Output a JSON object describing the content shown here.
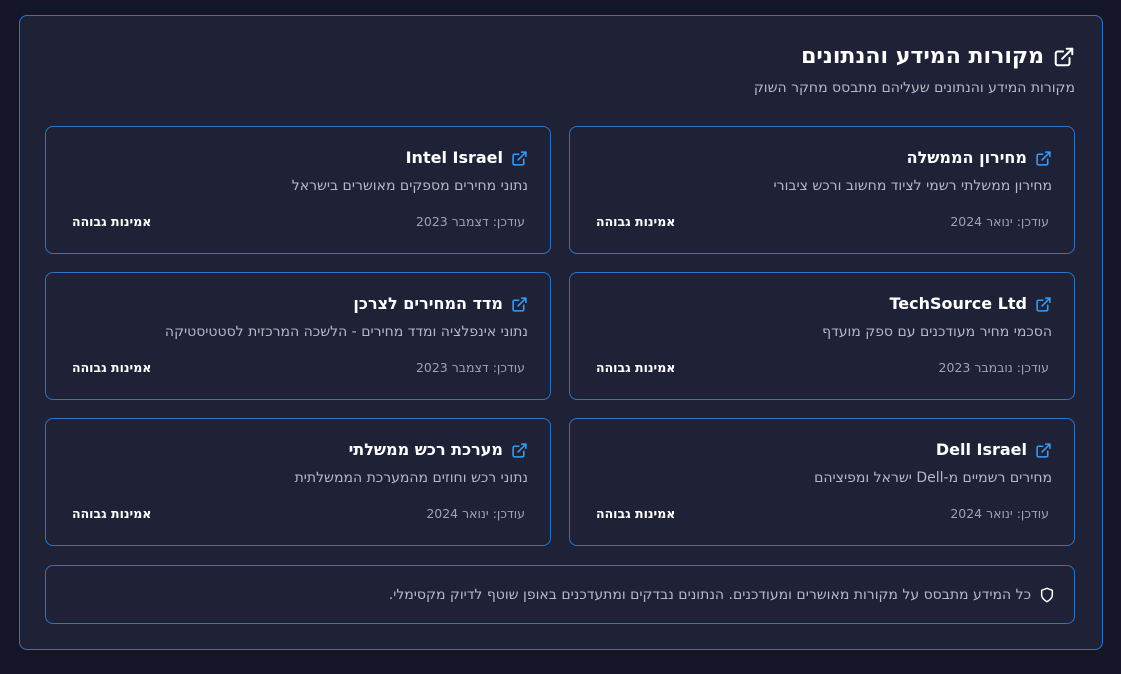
{
  "header": {
    "title": "מקורות המידע והנתונים",
    "subtitle": "מקורות המידע והנתונים שעליהם מתבסס מחקר השוק",
    "icon": "external-link-icon"
  },
  "sources": [
    {
      "name": "מחירון הממשלה",
      "description": "מחירון ממשלתי רשמי לציוד מחשוב ורכש ציבורי",
      "updated": "עודכן: ינואר 2024",
      "reliability": "אמינות גבוהה"
    },
    {
      "name": "Intel Israel",
      "description": "נתוני מחירים מספקים מאושרים בישראל",
      "updated": "עודכן: דצמבר 2023",
      "reliability": "אמינות גבוהה"
    },
    {
      "name": "TechSource Ltd",
      "description": "הסכמי מחיר מעודכנים עם ספק מועדף",
      "updated": "עודכן: נובמבר 2023",
      "reliability": "אמינות גבוהה"
    },
    {
      "name": "מדד המחירים לצרכן",
      "description": "נתוני אינפלציה ומדד מחירים - הלשכה המרכזית לסטטיסטיקה",
      "updated": "עודכן: דצמבר 2023",
      "reliability": "אמינות גבוהה"
    },
    {
      "name": "Dell Israel",
      "description": "מחירים רשמיים מ-Dell ישראל ומפיציהם",
      "updated": "עודכן: ינואר 2024",
      "reliability": "אמינות גבוהה"
    },
    {
      "name": "מערכת רכש ממשלתי",
      "description": "נתוני רכש וחוזים מהמערכת הממשלתית",
      "updated": "עודכן: ינואר 2024",
      "reliability": "אמינות גבוהה"
    }
  ],
  "note": {
    "text": "כל המידע מתבסס על מקורות מאושרים ומעודכנים. הנתונים נבדקים ומתעדכנים באופן שוטף לדיוק מקסימלי.",
    "icon": "shield-icon"
  },
  "colors": {
    "background": "#141628",
    "panel": "#1f2136",
    "border": "#2b74c9",
    "link_icon": "#3b9cf5"
  }
}
